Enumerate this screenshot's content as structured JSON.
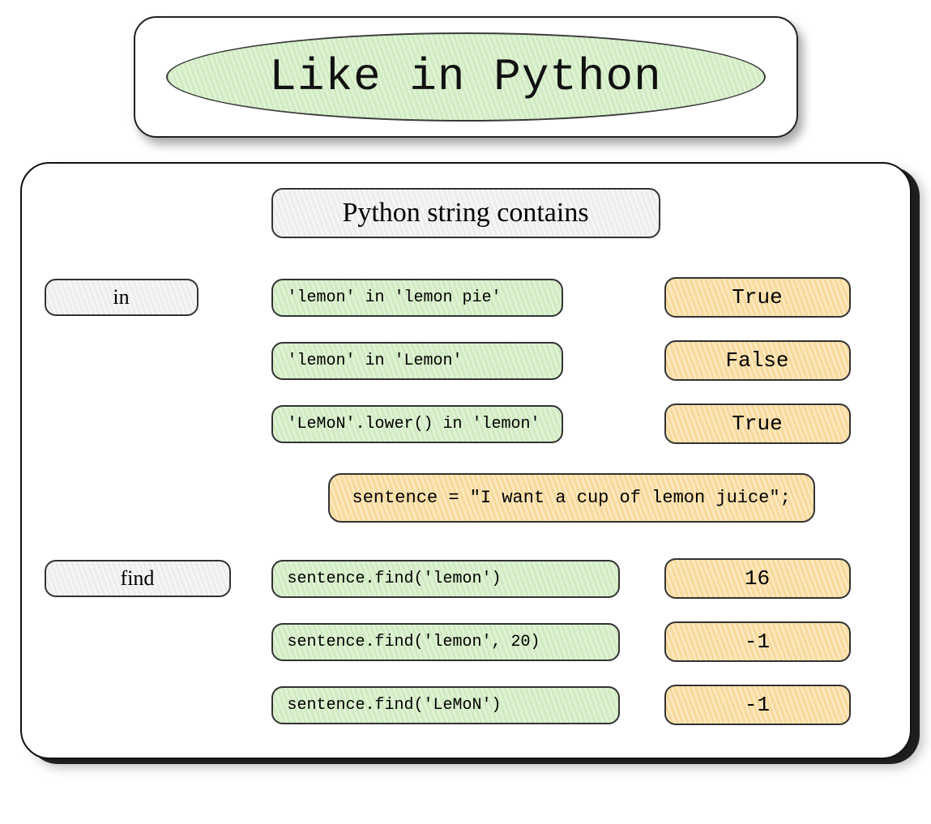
{
  "header": {
    "title": "Like in Python"
  },
  "subtitle": "Python string contains",
  "sections": {
    "in": {
      "label": "in",
      "rows": [
        {
          "code": "'lemon' in 'lemon pie'",
          "result": "True"
        },
        {
          "code": "'lemon' in 'Lemon'",
          "result": "False"
        },
        {
          "code": "'LeMoN'.lower() in 'lemon'",
          "result": "True"
        }
      ]
    },
    "sentence": "sentence = \"I want a cup of lemon juice\";",
    "find": {
      "label": "find",
      "rows": [
        {
          "code": "sentence.find('lemon')",
          "result": "16"
        },
        {
          "code": "sentence.find('lemon', 20)",
          "result": "-1"
        },
        {
          "code": "sentence.find('LeMoN')",
          "result": "-1"
        }
      ]
    }
  },
  "colors": {
    "green": "#cde9bd",
    "orange": "#f6d694",
    "gray": "#ededed"
  }
}
